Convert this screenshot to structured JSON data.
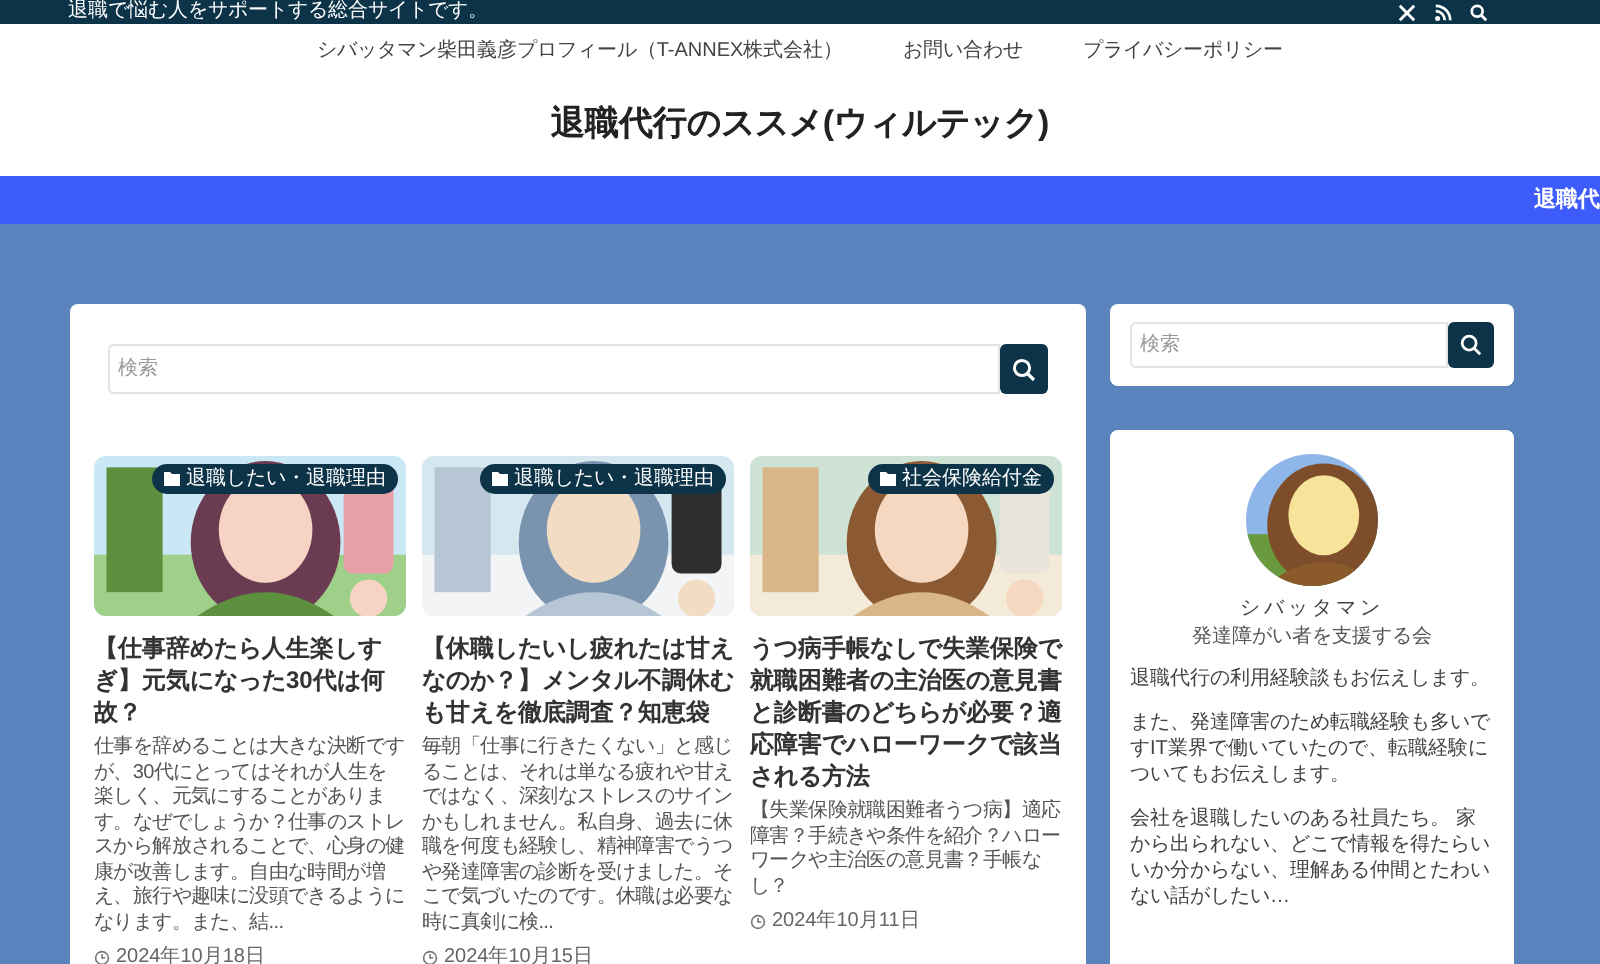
{
  "top_bar": {
    "tagline": "退職で悩む人をサポートする総合サイトです。"
  },
  "nav": [
    {
      "label": "シバッタマン柴田義彦プロフィール（T-ANNEX株式会社）"
    },
    {
      "label": "お問い合わせ"
    },
    {
      "label": "プライバシーポリシー"
    }
  ],
  "site_title": "退職代行のススメ(ウィルテック)",
  "ticker": {
    "text": "退職代"
  },
  "search": {
    "placeholder": "検索"
  },
  "articles": [
    {
      "category": "退職したい・退職理由",
      "title": "【仕事辞めたら人生楽しすぎ】元気になった30代は何故？",
      "excerpt": "仕事を辞めることは大きな決断ですが、30代にとってはそれが人生を楽しく、元気にすることがあります。なぜでしょうか？仕事のストレスから解放されることで、心身の健康が改善します。自由な時間が増え、旅行や趣味に没頭できるようになります。また、結...",
      "date": "2024年10月18日"
    },
    {
      "category": "退職したい・退職理由",
      "title": "【休職したいし疲れたは甘えなのか？】メンタル不調休むも甘えを徹底調査？知恵袋",
      "excerpt": "毎朝「仕事に行きたくない」と感じることは、それは単なる疲れや甘えではなく、深刻なストレスのサインかもしれません。私自身、過去に休職を何度も経験し、精神障害でうつや発達障害の診断を受けました。そこで気づいたのです。休職は必要な時に真剣に検...",
      "date": "2024年10月15日"
    },
    {
      "category": "社会保険給付金",
      "title": "うつ病手帳なしで失業保険で就職困難者の主治医の意見書と診断書のどちらが必要？適応障害でハローワークで該当される方法",
      "excerpt": "【失業保険就職困難者うつ病】適応障害？手続きや条件を紹介？ハローワークや主治医の意見書？手帳なし？",
      "date": "2024年10月11日"
    }
  ],
  "sidebar": {
    "search": {
      "placeholder": "検索"
    },
    "profile": {
      "name": "シバッタマン",
      "subtitle": "発達障がい者を支援する会",
      "paragraphs": [
        "退職代行の利用経験談もお伝えします。",
        "また、発達障害のため転職経験も多いですIT業界で働いていたので、転職経験についてもお伝えします。",
        "会社を退職したいのある社員たち。 家から出られない、どこで情報を得たらいいか分からない、理解ある仲間とたわいない話がしたい…"
      ]
    }
  }
}
